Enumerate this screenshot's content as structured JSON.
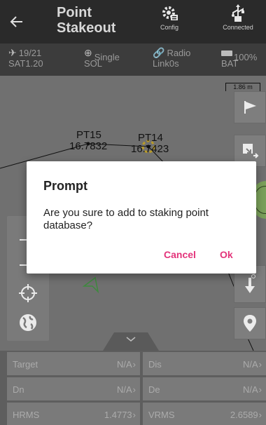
{
  "header": {
    "title_line1": "Point",
    "title_line2": "Stakeout",
    "config_label": "Config",
    "connected_label": "Connected",
    "back_icon": "arrow-left-icon"
  },
  "status": {
    "sat_top": "19/21",
    "sat_bottom": "SAT1.20",
    "sol_top": "Single",
    "sol_bottom": "SOL",
    "radio_top": "Radio",
    "radio_bottom": "Link0s",
    "battery_top": "100%",
    "battery_bottom": "BAT"
  },
  "map": {
    "scale_label": "1.86 m",
    "points": [
      {
        "name": "PT15",
        "value": "16.7832"
      },
      {
        "name": "PT14",
        "value": "16.7423"
      }
    ]
  },
  "info": [
    {
      "label": "Target",
      "value": "N/A"
    },
    {
      "label": "Dis",
      "value": "N/A"
    },
    {
      "label": "Dn",
      "value": "N/A"
    },
    {
      "label": "De",
      "value": "N/A"
    },
    {
      "label": "HRMS",
      "value": "1.4773"
    },
    {
      "label": "VRMS",
      "value": "2.6589"
    }
  ],
  "dialog": {
    "title": "Prompt",
    "message": "Are you sure to add to staking point database?",
    "cancel_label": "Cancel",
    "ok_label": "Ok"
  },
  "colors": {
    "accent": "#e3337a",
    "header_bg": "#2a2a2a",
    "status_bg": "#3c3c3c",
    "map_bg": "#707070",
    "location_marker": "#7aa05a"
  }
}
